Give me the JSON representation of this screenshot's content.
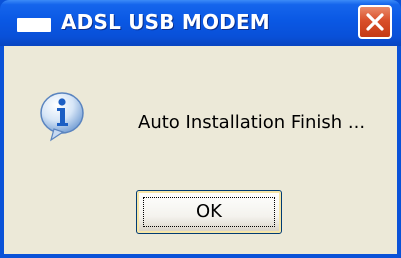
{
  "window": {
    "title": "ADSL USB MODEM",
    "title_icon": "window-icon",
    "close_icon": "close-icon"
  },
  "dialog": {
    "icon": "information-icon",
    "message": "Auto Installation Finish ...",
    "ok_label": "OK"
  },
  "colors": {
    "titlebar": "#0a58e4",
    "dialog_background": "#ece9d8",
    "close_button": "#d94f2a",
    "info_icon_blue": "#1c5fc4"
  }
}
